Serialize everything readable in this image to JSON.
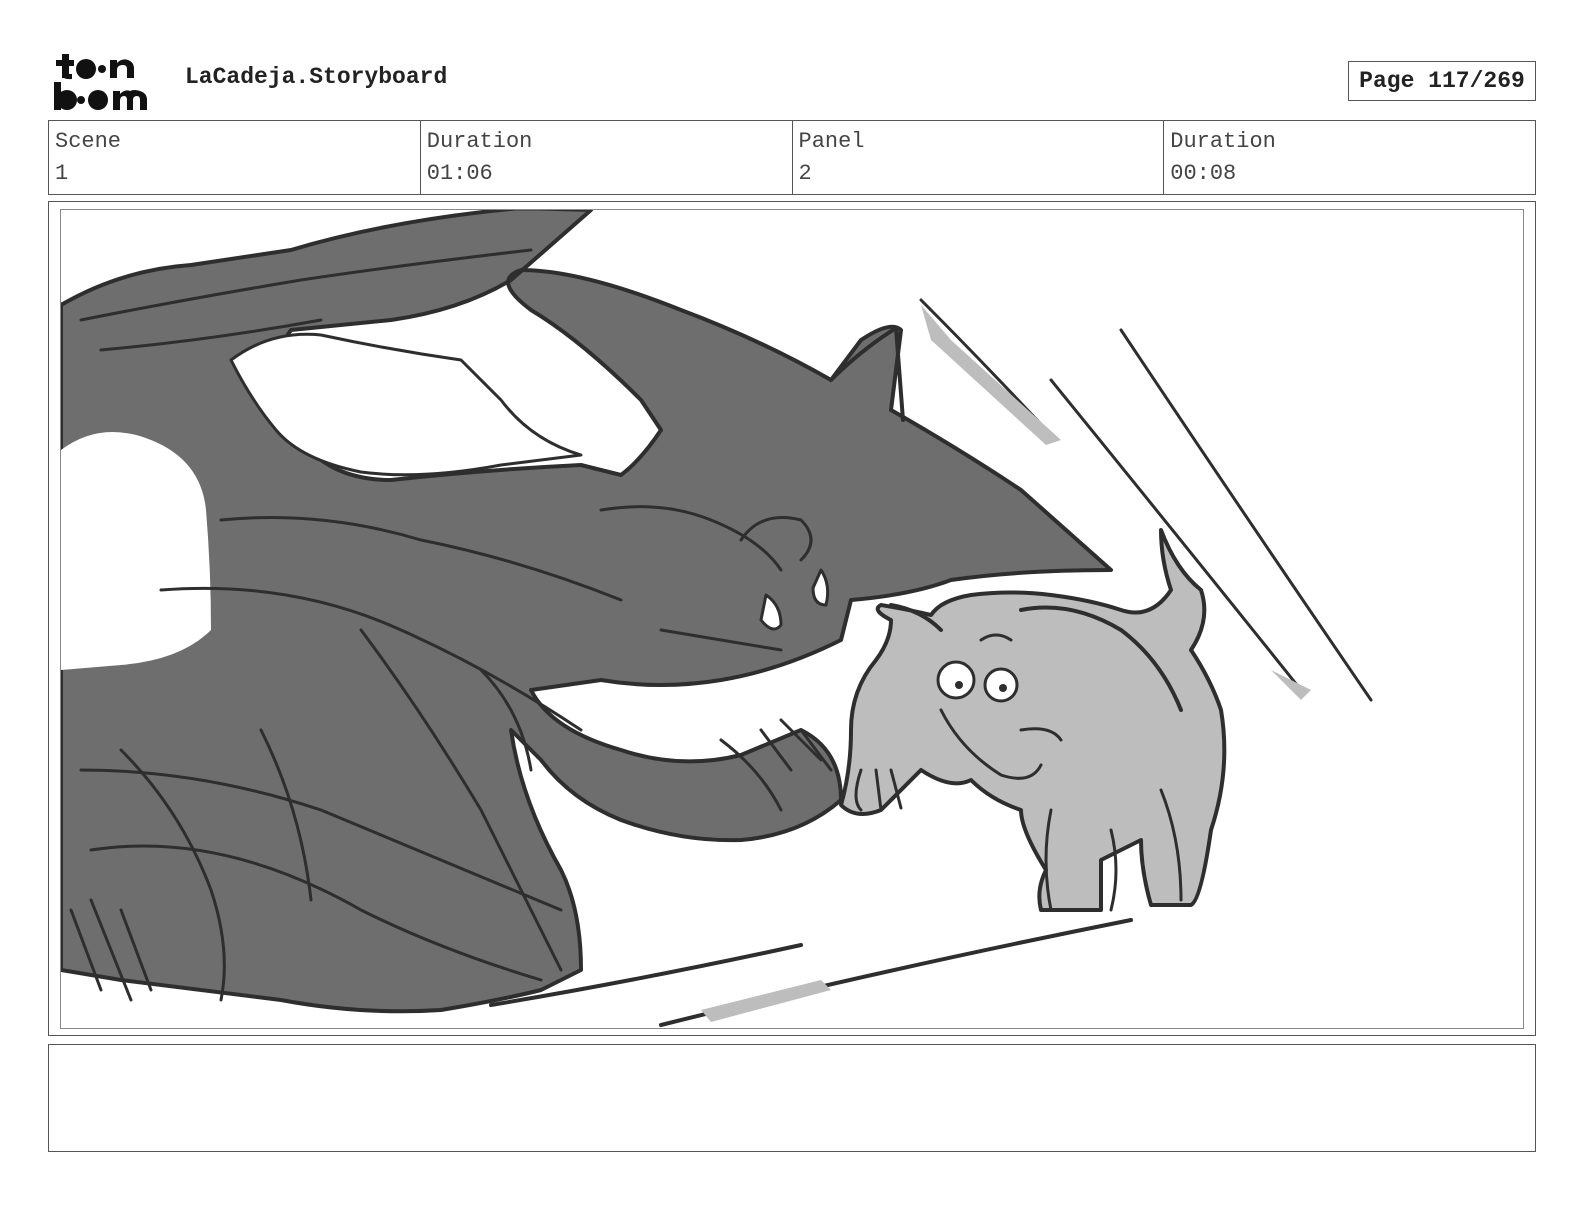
{
  "header": {
    "logo_text": "toon boom",
    "doc_title": "LaCadeja.Storyboard",
    "page_label": "Page 117/269"
  },
  "info": {
    "scene_label": "Scene",
    "scene_value": "1",
    "scene_duration_label": "Duration",
    "scene_duration_value": "01:06",
    "panel_label": "Panel",
    "panel_value": "2",
    "panel_duration_label": "Duration",
    "panel_duration_value": "00:08"
  },
  "colors": {
    "sketch_dark": "#6e6e6e",
    "sketch_light": "#bdbdbd",
    "line": "#2e2e2e"
  }
}
